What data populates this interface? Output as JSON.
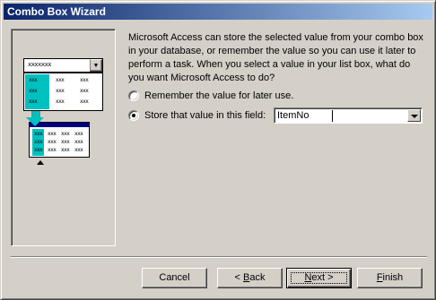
{
  "window": {
    "title": "Combo Box Wizard"
  },
  "illustration": {
    "combo_text": "xxxxxxx",
    "list_rows": [
      [
        "xxx",
        "xxx",
        "xxx"
      ],
      [
        "xxx",
        "xxx",
        "xxx"
      ],
      [
        "xxx",
        "xxx",
        "xxx"
      ]
    ],
    "table_rows": [
      [
        "xxx",
        "xxx",
        "xxx",
        "xxx"
      ],
      [
        "xxx",
        "xxx",
        "xxx",
        "xxx"
      ],
      [
        "xxx",
        "xxx",
        "xxx",
        "xxx"
      ]
    ]
  },
  "instructions": "Microsoft Access can store the selected value from your combo box in your database, or remember the value so you can use it later to perform a task.  When you select a value in your list box, what do you want Microsoft Access to do?",
  "options": {
    "remember": {
      "label": "Remember the value for later use.",
      "selected": false
    },
    "store": {
      "label": "Store that value in this field:",
      "selected": true
    }
  },
  "field_select": {
    "value": "ItemNo"
  },
  "buttons": {
    "cancel": "Cancel",
    "back_prefix": "< ",
    "back_accel": "B",
    "back_rest": "ack",
    "next_accel": "N",
    "next_rest": "ext >",
    "finish_accel": "F",
    "finish_rest": "inish"
  },
  "colors": {
    "titlebar_start": "#0a246a",
    "titlebar_end": "#a6caf0",
    "highlight": "#00c0c0",
    "face": "#d4d0c8"
  }
}
